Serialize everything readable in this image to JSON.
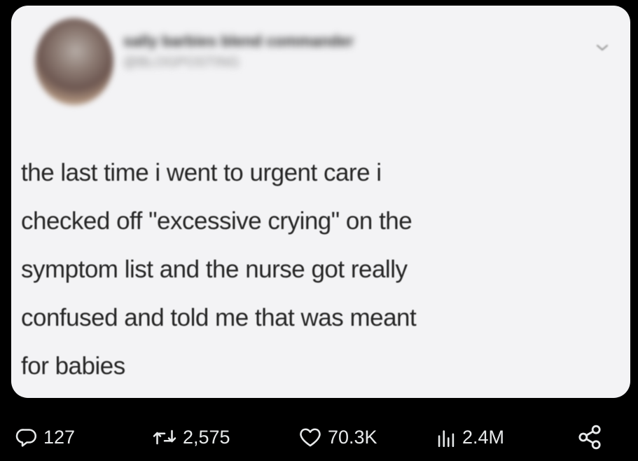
{
  "post": {
    "author_name": "sally barbies blend commander",
    "author_handle": "@BLOGPOSTING",
    "text": "the last time i went to urgent care i\nchecked off \"excessive crying\" on the\nsymptom list and the nurse got really\nconfused and told me that was meant\nfor babies"
  },
  "actions": {
    "replies": "127",
    "reposts": "2,575",
    "likes": "70.3K",
    "views": "2.4M"
  },
  "icons": {
    "reply": "reply-icon",
    "repost": "repost-icon",
    "like": "heart-icon",
    "views": "views-icon",
    "share": "share-icon",
    "more": "chevron-down-icon"
  },
  "colors": {
    "background": "#000000",
    "card": "#f3f3f5",
    "text": "#262626",
    "action_text": "#e7e9ea"
  }
}
